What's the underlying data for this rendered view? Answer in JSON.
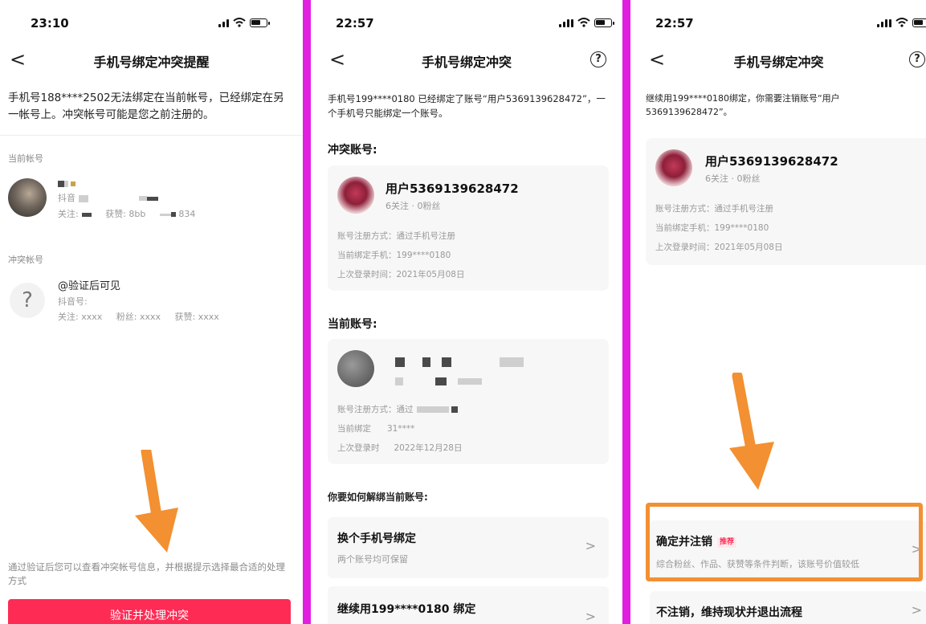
{
  "panels": {
    "p1": {
      "status_time": "23:10",
      "nav_title": "手机号绑定冲突提醒",
      "back_glyph": "<",
      "message": "手机号188****2502无法绑定在当前帐号，已经绑定在另一帐号上。冲突帐号可能是您之前注册的。",
      "current_label": "当前帐号",
      "current_account": {
        "line2_prefix": "抖音",
        "follow_prefix": "关注:",
        "likes_prefix": "获赞: 8bb",
        "fans_value": "834"
      },
      "conflict_label": "冲突帐号",
      "conflict_account": {
        "avatar_glyph": "?",
        "name": "@验证后可见",
        "douyin_id": "抖音号:",
        "follow": "关注: xxxx",
        "fans": "粉丝: xxxx",
        "likes": "获赞: xxxx"
      },
      "bottom_note": "通过验证后您可以查看冲突帐号信息，并根据提示选择最合适的处理方式",
      "primary_button": "验证并处理冲突"
    },
    "p2": {
      "status_time": "22:57",
      "nav_title": "手机号绑定冲突",
      "back_glyph": "<",
      "help_glyph": "?",
      "message": "手机号199****0180 已经绑定了账号“用户5369139628472”，一个手机号只能绑定一个账号。",
      "conflict_title": "冲突账号:",
      "conflict_card": {
        "name": "用户5369139628472",
        "stats": "6关注 · 0粉丝",
        "reg": "账号注册方式：通过手机号注册",
        "phone": "当前绑定手机：199****0180",
        "last_login": "上次登录时间：2021年05月08日"
      },
      "current_title": "当前账号:",
      "current_card": {
        "reg": "账号注册方式：通过",
        "phone_prefix": "当前绑定",
        "phone_value": "31****",
        "last_login_prefix": "上次登录时",
        "last_login_value": "2022年12月28日"
      },
      "question": "你要如何解绑当前账号:",
      "options": [
        {
          "title": "换个手机号绑定",
          "sub": "两个账号均可保留",
          "chev": ">"
        },
        {
          "title": "继续用199****0180 绑定",
          "sub": "",
          "chev": ">"
        }
      ]
    },
    "p3": {
      "status_time": "22:57",
      "nav_title": "手机号绑定冲突",
      "back_glyph": "<",
      "help_glyph": "?",
      "message": "继续用199****0180绑定，你需要注销账号“用户5369139628472”。",
      "card": {
        "name": "用户5369139628472",
        "stats": "6关注 · 0粉丝",
        "reg": "账号注册方式：通过手机号注册",
        "phone": "当前绑定手机：199****0180",
        "last_login": "上次登录时间：2021年05月08日"
      },
      "options": [
        {
          "title": "确定并注销",
          "badge": "推荐",
          "sub": "综合粉丝、作品、获赞等条件判断，该账号价值较低",
          "chev": ">"
        },
        {
          "title": "不注销，维持现状并退出流程",
          "chev": ">"
        }
      ]
    }
  },
  "colors": {
    "divider": "#e11fe1",
    "primary": "#fe2c55",
    "arrow": "#f29032",
    "card_bg": "#f7f7f7"
  },
  "icons": [
    "back-icon",
    "help-icon",
    "signal-icon",
    "wifi-icon",
    "battery-icon",
    "chevron-right-icon",
    "arrow-down-icon"
  ]
}
